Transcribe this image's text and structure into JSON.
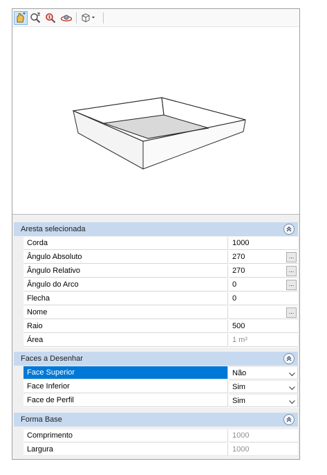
{
  "toolbar": {
    "buttons": [
      {
        "icon": "orbit-pan-icon",
        "active": true
      },
      {
        "icon": "zoom-extents-icon"
      },
      {
        "icon": "zoom-icon"
      },
      {
        "icon": "orbit-icon"
      },
      {
        "icon": "view-cube-dropdown-icon"
      }
    ]
  },
  "groups": [
    {
      "title": "Aresta selecionada",
      "rows": [
        {
          "label": "Corda",
          "value": "1000"
        },
        {
          "label": "Ângulo Absoluto",
          "value": "270",
          "button": "..."
        },
        {
          "label": "Ângulo Relativo",
          "value": "270",
          "button": "..."
        },
        {
          "label": "Ângulo do Arco",
          "value": "0",
          "button": "..."
        },
        {
          "label": "Flecha",
          "value": "0"
        },
        {
          "label": "Nome",
          "value": "",
          "button": "..."
        },
        {
          "label": "Raio",
          "value": "500"
        },
        {
          "label": "Área",
          "value": "1 m²",
          "readonly": true
        }
      ]
    },
    {
      "title": "Faces a Desenhar",
      "rows": [
        {
          "label": "Face Superior",
          "value": "Não",
          "selected": true
        },
        {
          "label": "Face Inferior",
          "value": "Sim"
        },
        {
          "label": "Face de Perfil",
          "value": "Sim"
        }
      ]
    },
    {
      "title": "Forma Base",
      "rows": [
        {
          "label": "Comprimento",
          "value": "1000",
          "readonly": true
        },
        {
          "label": "Largura",
          "value": "1000",
          "readonly": true
        }
      ]
    }
  ],
  "colors": {
    "category_header": "#c7d9ef",
    "selection": "#0078d7",
    "readonly_text": "#8e8e8e"
  }
}
